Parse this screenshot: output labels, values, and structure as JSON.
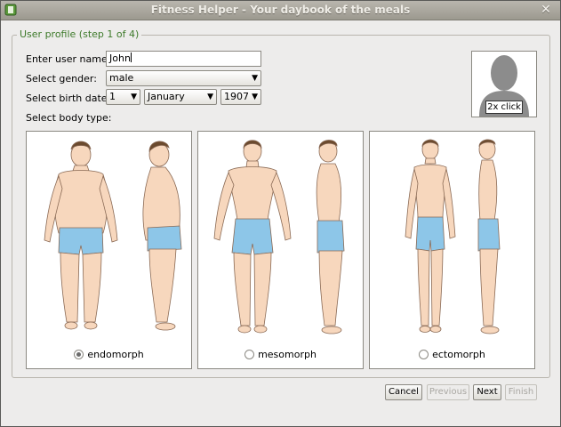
{
  "window": {
    "title": "Fitness Helper - Your daybook of the meals",
    "close_glyph": "✕"
  },
  "group": {
    "title": "User profile (step 1 of 4)"
  },
  "form": {
    "username_label": "Enter user name:",
    "username_value": "John",
    "gender_label": "Select gender:",
    "gender_value": "male",
    "birth_label": "Select birth date:",
    "birth_day": "1",
    "birth_month": "January",
    "birth_year": "1907",
    "bodytype_label": "Select body type:"
  },
  "photo": {
    "caption": "2x click"
  },
  "body_types": [
    {
      "label": "endomorph",
      "selected": true
    },
    {
      "label": "mesomorph",
      "selected": false
    },
    {
      "label": "ectomorph",
      "selected": false
    }
  ],
  "buttons": {
    "cancel": "Cancel",
    "previous": "Previous",
    "next": "Next",
    "finish": "Finish"
  },
  "colors": {
    "skin": "#f7d7bd",
    "shorts": "#8dc6e8",
    "hair": "#6b4a2e",
    "group_title": "#3d7a2a"
  }
}
